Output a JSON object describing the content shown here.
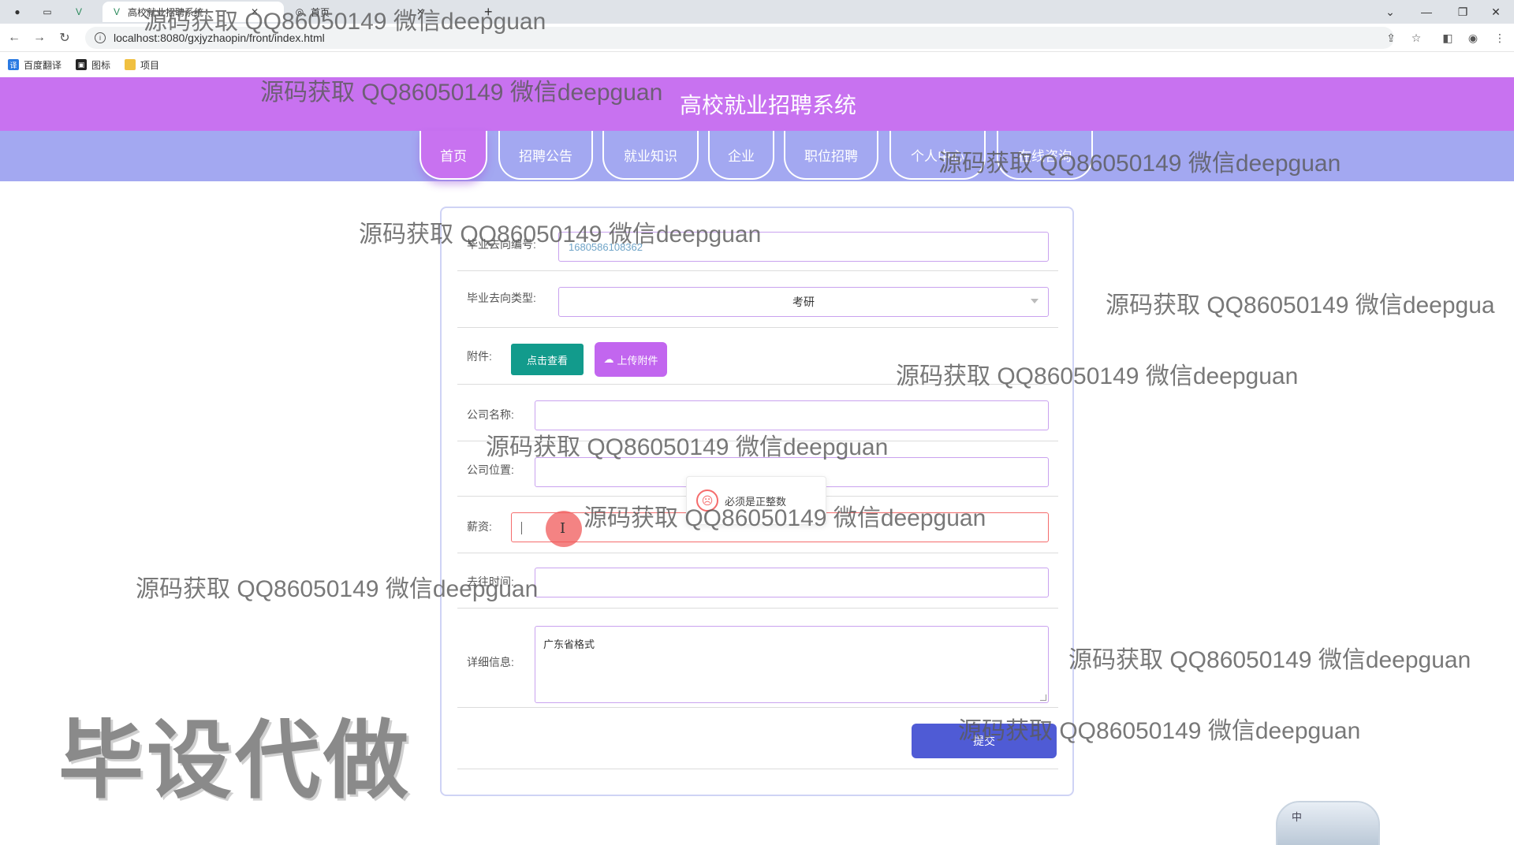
{
  "browser": {
    "tabs": [
      {
        "label": ""
      },
      {
        "label": "高校就业招聘系统"
      },
      {
        "label": "首页"
      }
    ],
    "new_tab": "+",
    "url": "localhost:8080/gxjyzhaopin/front/index.html",
    "bookmarks": [
      {
        "label": "百度翻译",
        "color": "#2a7ae2"
      },
      {
        "label": "图标",
        "color": "#222222"
      },
      {
        "label": "项目",
        "color": "#f0c040"
      }
    ]
  },
  "site": {
    "title": "高校就业招聘系统",
    "nav": [
      {
        "label": "首页",
        "active": true
      },
      {
        "label": "招聘公告"
      },
      {
        "label": "就业知识"
      },
      {
        "label": "企业"
      },
      {
        "label": "职位招聘"
      },
      {
        "label": "个人中心"
      },
      {
        "label": "在线咨询"
      }
    ]
  },
  "form": {
    "id_label": "毕业去向编号:",
    "id_value": "1680586108362",
    "type_label": "毕业去向类型:",
    "type_value": "考研",
    "attachment_label": "附件:",
    "view_button": "点击查看",
    "upload_button": "上传附件",
    "company_name_label": "公司名称:",
    "company_name_value": "",
    "company_location_label": "公司位置:",
    "company_location_value": "",
    "salary_label": "薪资:",
    "salary_value": "",
    "salary_error": "必须是正整数",
    "time_label": "去往时间:",
    "time_value": "",
    "detail_label": "详细信息:",
    "detail_value": "广东省格式",
    "submit_label": "提交"
  },
  "overlay": {
    "watermark": "源码获取 QQ86050149 微信deepguan",
    "watermark_cut": "源码获取 QQ86050149 微信deepgua",
    "stamp": "毕设代做",
    "ime_label": "中"
  },
  "colors": {
    "header": "#c872f0",
    "menubar": "#a3a8f1",
    "view_button": "#129b8c",
    "upload_button": "#c266ef",
    "submit": "#4f5bd5",
    "error": "#f56c6c"
  }
}
